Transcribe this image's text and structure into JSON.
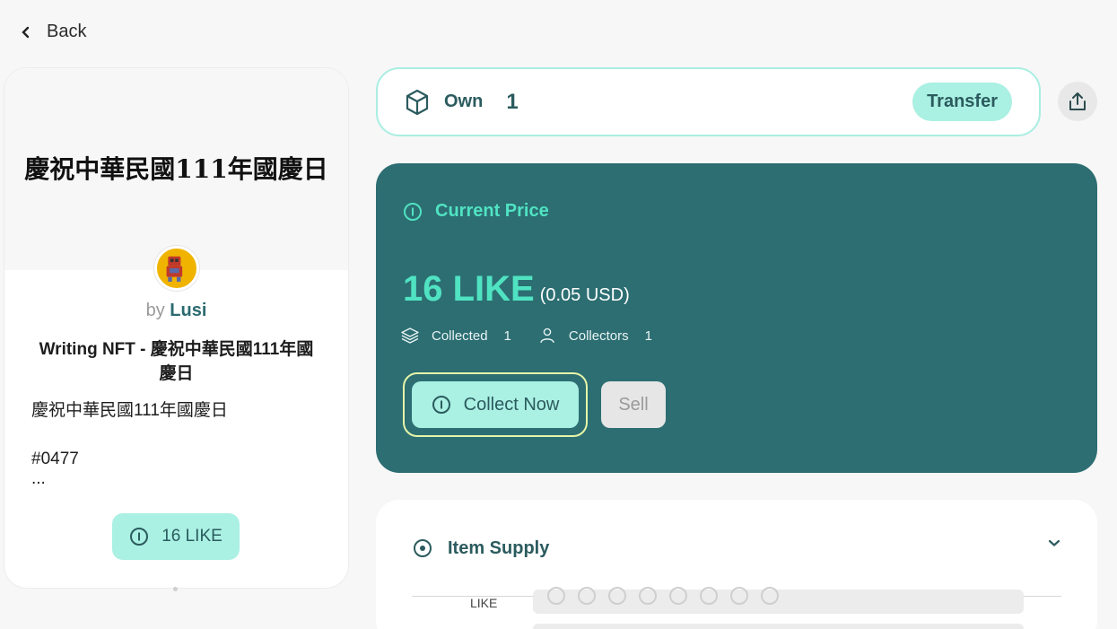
{
  "nav": {
    "back_label": "Back"
  },
  "nft_card": {
    "banner_title": "慶祝中華民國111年國慶日",
    "by_prefix": "by",
    "author": "Lusi",
    "title": "Writing NFT - 慶祝中華民國111年國慶日",
    "description_line": "慶祝中華民國111年國慶日",
    "number": "#0477",
    "more": "...",
    "price_label": "16 LIKE"
  },
  "ownership": {
    "label": "Own",
    "count": "1",
    "transfer_label": "Transfer"
  },
  "price_panel": {
    "header": "Current Price",
    "price": "16 LIKE",
    "usd": "(0.05 USD)",
    "collected_label": "Collected",
    "collected_value": "1",
    "collectors_label": "Collectors",
    "collectors_value": "1",
    "collect_label": "Collect Now",
    "sell_label": "Sell"
  },
  "supply": {
    "header": "Item Supply",
    "unit_label": "LIKE"
  },
  "colors": {
    "accent": "#50e3c2",
    "panel": "#2c6e72",
    "pill": "#aaf0e3",
    "text_dark": "#2b5b5e"
  }
}
